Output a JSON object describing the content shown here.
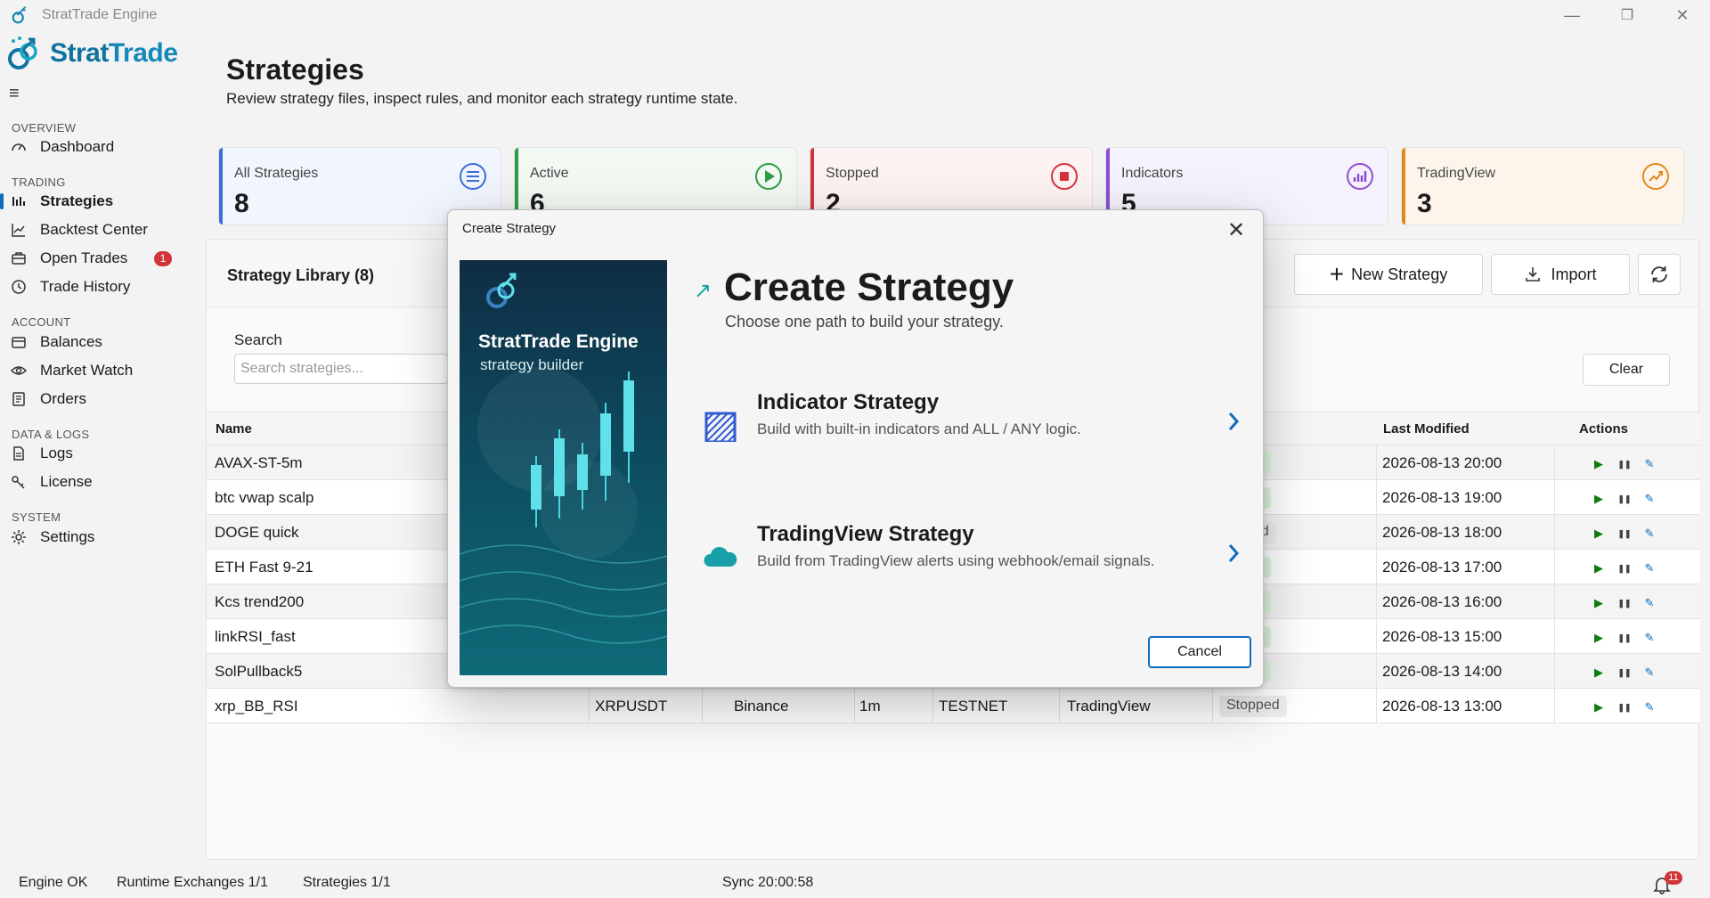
{
  "window": {
    "title": "StratTrade Engine",
    "minimize_glyph": "—",
    "restore_glyph": "❐",
    "close_glyph": "✕"
  },
  "brand": {
    "logo_text_1": "Strat",
    "logo_text_2": "Trade",
    "accent": "#1487b8"
  },
  "sidebar": {
    "hamburger": "≡",
    "sections": {
      "overview": "OVERVIEW",
      "trading": "TRADING",
      "account": "ACCOUNT",
      "data_logs": "DATA & LOGS",
      "system": "SYSTEM"
    },
    "items": {
      "dashboard": "Dashboard",
      "strategies": "Strategies",
      "backtest": "Backtest Center",
      "open_trades": "Open Trades",
      "open_trades_badge": "1",
      "trade_history": "Trade History",
      "balances": "Balances",
      "market_watch": "Market Watch",
      "orders": "Orders",
      "logs": "Logs",
      "license": "License",
      "settings": "Settings"
    }
  },
  "page": {
    "title": "Strategies",
    "subtitle": "Review strategy files, inspect rules, and monitor each strategy runtime state."
  },
  "stats": {
    "all": {
      "label": "All Strategies",
      "value": "8",
      "color": "#3b6fd8"
    },
    "active": {
      "label": "Active",
      "value": "6",
      "color": "#2e9d49"
    },
    "stopped": {
      "label": "Stopped",
      "value": "2",
      "color": "#d13438"
    },
    "indicators": {
      "label": "Indicators",
      "value": "5",
      "color": "#8a4fd1"
    },
    "tradingview": {
      "label": "TradingView",
      "value": "3",
      "color": "#e08a1e"
    }
  },
  "library": {
    "title": "Strategy Library (8)",
    "new_label": "New Strategy",
    "import_label": "Import",
    "search_label": "Search",
    "search_placeholder": "Search strategies...",
    "clear_label": "Clear",
    "columns": {
      "name": "Name",
      "last_modified": "Last Modified",
      "actions": "Actions"
    },
    "rows": [
      {
        "name": "AVAX-ST-5m",
        "status": "ing",
        "modified": "2026-08-13 20:00"
      },
      {
        "name": "btc vwap scalp",
        "status": "ing",
        "modified": "2026-08-13 19:00"
      },
      {
        "name": "DOGE quick",
        "status": "ped",
        "modified": "2026-08-13 18:00"
      },
      {
        "name": "ETH Fast 9-21",
        "status": "ing",
        "modified": "2026-08-13 17:00"
      },
      {
        "name": "Kcs trend200",
        "status": "ing",
        "modified": "2026-08-13 16:00"
      },
      {
        "name": "linkRSI_fast",
        "status": "ing",
        "modified": "2026-08-13 15:00"
      },
      {
        "name": "SolPullback5",
        "status": "ing",
        "modified": "2026-08-13 14:00"
      },
      {
        "name": "xrp_BB_RSI",
        "symbol": "XRPUSDT",
        "exchange": "Binance",
        "timeframe": "1m",
        "mode": "TESTNET",
        "source": "TradingView",
        "status": "Stopped",
        "modified": "2026-08-13 13:00"
      }
    ]
  },
  "statusbar": {
    "engine": "Engine OK",
    "exchanges": "Runtime Exchanges 1/1",
    "strategies": "Strategies 1/1",
    "sync": "Sync 20:00:58",
    "notifications": "11"
  },
  "dialog": {
    "title": "Create Strategy",
    "close_glyph": "✕",
    "hero_title": "StratTrade Engine",
    "hero_subtitle": "strategy builder",
    "heading": "Create Strategy",
    "subheading": "Choose one path to build your strategy.",
    "options": [
      {
        "title": "Indicator Strategy",
        "desc": "Build with built-in indicators and ALL / ANY logic."
      },
      {
        "title": "TradingView Strategy",
        "desc": "Build from TradingView alerts using webhook/email signals."
      }
    ],
    "cancel_label": "Cancel"
  }
}
